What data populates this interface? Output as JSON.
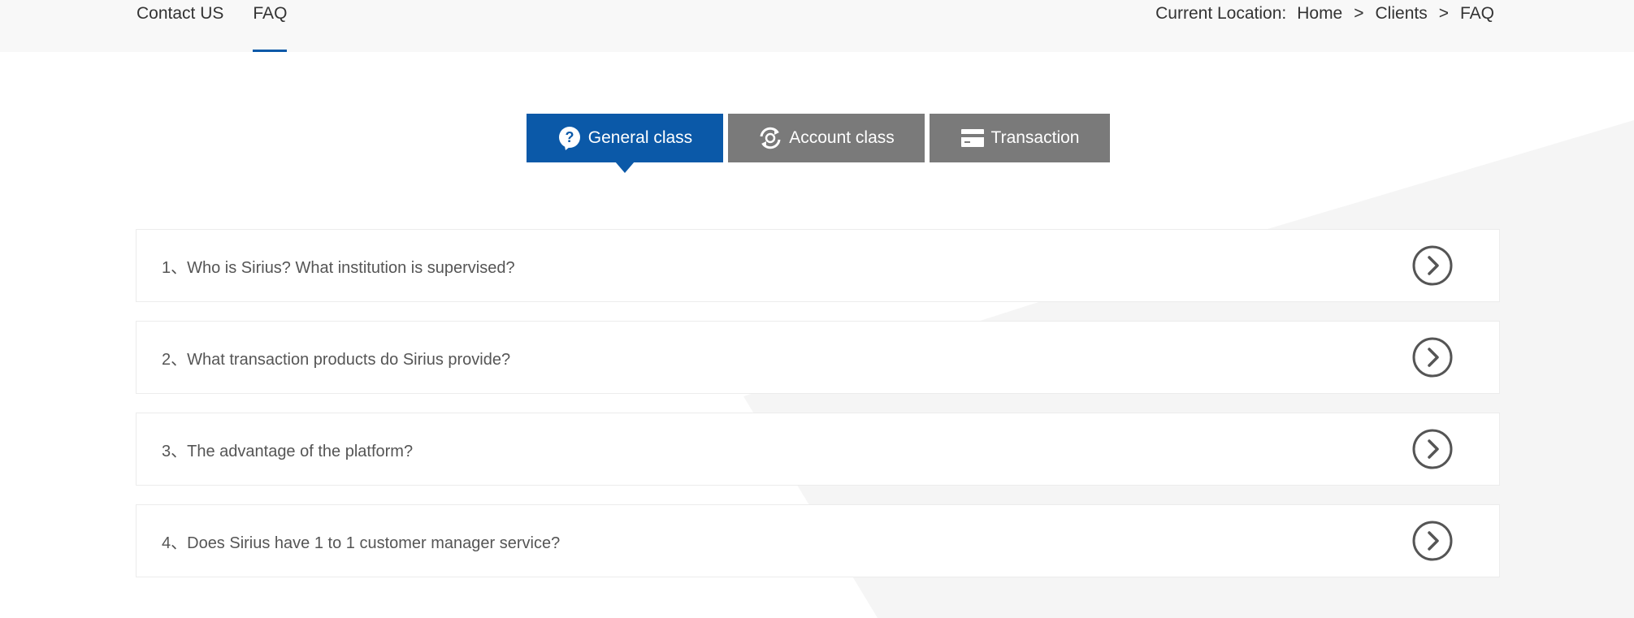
{
  "sub_nav": {
    "items": [
      {
        "label": "Contact US",
        "active": false
      },
      {
        "label": "FAQ",
        "active": true
      }
    ]
  },
  "breadcrumb": {
    "label": "Current Location:",
    "items": [
      "Home",
      "Clients",
      "FAQ"
    ],
    "separator": ">"
  },
  "tabs": [
    {
      "label": "General class",
      "icon": "question-icon",
      "active": true
    },
    {
      "label": "Account class",
      "icon": "account-exchange-icon",
      "active": false
    },
    {
      "label": "Transaction",
      "icon": "card-icon",
      "active": false
    }
  ],
  "faq": {
    "items": [
      {
        "label": "1、Who is Sirius? What institution is supervised?"
      },
      {
        "label": "2、What transaction products do Sirius provide?"
      },
      {
        "label": "3、The advantage of the platform?"
      },
      {
        "label": "4、Does Sirius have 1 to 1 customer manager service?"
      }
    ],
    "arrow_icon": "chevron-right-circle-icon"
  },
  "colors": {
    "accent": "#0b59a8",
    "tab_inactive": "#7a7a7a",
    "top_bar_bg": "#f8f8f8",
    "text": "#333333"
  }
}
